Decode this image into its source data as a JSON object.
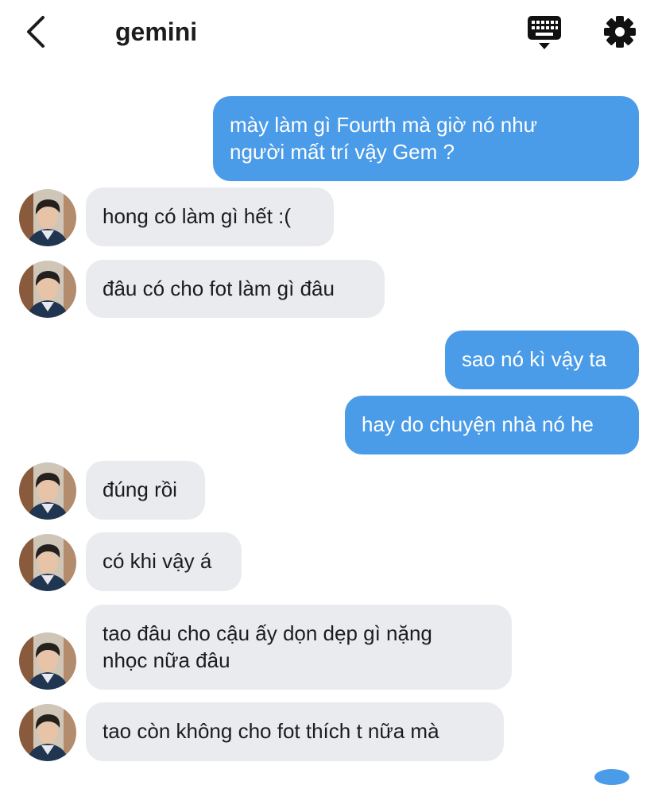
{
  "header": {
    "title": "gemini",
    "back_icon": "chevron-left-icon",
    "keyboard_icon": "keyboard-icon",
    "settings_icon": "gear-icon"
  },
  "colors": {
    "outgoing_bubble": "#4a9be8",
    "incoming_bubble": "#e9ebef",
    "text": "#1c1c1e"
  },
  "messages": [
    {
      "from": "me",
      "text": "mày làm gì Fourth mà giờ nó như\nngười mất trí vậy Gem ?"
    },
    {
      "from": "gemini",
      "text": "hong có làm gì hết :("
    },
    {
      "from": "gemini",
      "text": "đâu có cho fot làm gì đâu"
    },
    {
      "from": "me",
      "text": "sao nó kì vậy ta"
    },
    {
      "from": "me",
      "text": "hay do chuyện nhà nó he"
    },
    {
      "from": "gemini",
      "text": "đúng rồi"
    },
    {
      "from": "gemini",
      "text": "có khi vậy á"
    },
    {
      "from": "gemini",
      "text": "tao đâu cho cậu ấy dọn dẹp gì nặng\nnhọc nữa đâu"
    },
    {
      "from": "gemini",
      "text": "tao còn không cho fot thích t nữa mà"
    }
  ]
}
